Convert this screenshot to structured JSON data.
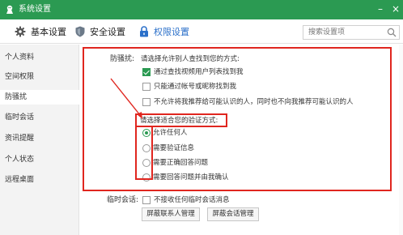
{
  "window": {
    "title": "系统设置",
    "min_glyph": "–",
    "close_glyph": "×"
  },
  "toolbar": {
    "tabs": [
      {
        "label": "基本设置",
        "icon": "gear-icon"
      },
      {
        "label": "安全设置",
        "icon": "shield-icon"
      },
      {
        "label": "权限设置",
        "icon": "lock-icon"
      }
    ],
    "active_tab": "权限设置",
    "search_placeholder": "搜索设置项"
  },
  "sidebar": {
    "items": [
      {
        "label": "个人资料"
      },
      {
        "label": "空间权限"
      },
      {
        "label": "防骚扰"
      },
      {
        "label": "临时会话"
      },
      {
        "label": "资讯提醒"
      },
      {
        "label": "个人状态"
      },
      {
        "label": "远程桌面"
      }
    ],
    "active": "防骚扰"
  },
  "anti_harass": {
    "label": "防骚扰:",
    "find_prompt": "请选择允许别人查找到您的方式:",
    "find_options": [
      {
        "label": "通过查找视频用户列表找到我",
        "checked": true
      },
      {
        "label": "只能通过帐号或昵称找到我",
        "checked": false
      },
      {
        "label": "不允许将我推荐给可能认识的人，同时也不向我推荐可能认识的人",
        "checked": false
      }
    ],
    "verify_prompt": "请选择适合您的验证方式:",
    "verify_options": [
      {
        "label": "允许任何人",
        "selected": true
      },
      {
        "label": "需要验证信息",
        "selected": false
      },
      {
        "label": "需要正确回答问题",
        "selected": false
      },
      {
        "label": "需要回答问题并由我确认",
        "selected": false
      }
    ]
  },
  "temp_session": {
    "label": "临时会话:",
    "option": {
      "label": "不接收任何临时会话消息",
      "checked": false
    },
    "buttons": {
      "contacts": "屏蔽联系人管理",
      "sessions": "屏蔽会话管理"
    }
  },
  "colors": {
    "title_bar": "#2b9a52",
    "accent_blue": "#2a6fc9",
    "highlight_red": "#e0261f",
    "check_green": "#2b9a52"
  }
}
